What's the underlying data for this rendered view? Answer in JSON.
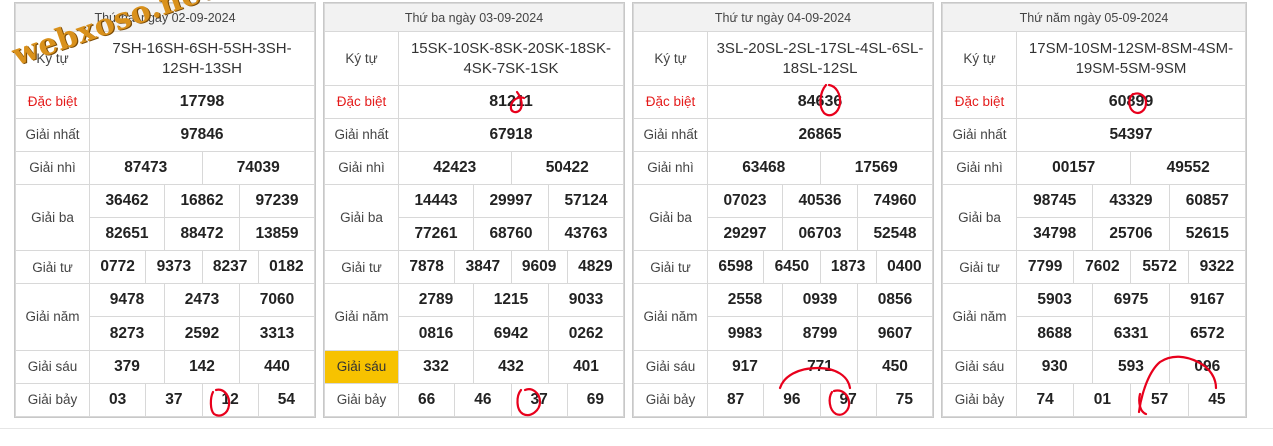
{
  "watermark": "webxoso.net",
  "labels": {
    "ky_tu": "Ký tự",
    "dac_biet": "Đặc biệt",
    "nhat": "Giải nhất",
    "nhi": "Giải nhì",
    "ba": "Giải ba",
    "tu": "Giải tư",
    "nam": "Giải năm",
    "sau": "Giải sáu",
    "bay": "Giải bảy"
  },
  "colors": {
    "special_text": "#e41b1b",
    "highlight_label": "#f7c200",
    "annotation": "#e8001c"
  },
  "tables": [
    {
      "date": "Thứ hai ngày 02-09-2024",
      "ky_tu": "7SH-16SH-6SH-5SH-3SH-12SH-13SH",
      "dac_biet": "17798",
      "nhat": "97846",
      "nhi": [
        "87473",
        "74039"
      ],
      "ba": [
        "36462",
        "16862",
        "97239",
        "82651",
        "88472",
        "13859"
      ],
      "tu": [
        "0772",
        "9373",
        "8237",
        "0182"
      ],
      "nam": [
        "9478",
        "2473",
        "7060",
        "8273",
        "2592",
        "3313"
      ],
      "sau": [
        "379",
        "142",
        "440"
      ],
      "bay": [
        "03",
        "37",
        "12",
        "54"
      ]
    },
    {
      "date": "Thứ ba ngày 03-09-2024",
      "ky_tu": "15SK-10SK-8SK-20SK-18SK-4SK-7SK-1SK",
      "dac_biet": "81211",
      "nhat": "67918",
      "nhi": [
        "42423",
        "50422"
      ],
      "ba": [
        "14443",
        "29997",
        "57124",
        "77261",
        "68760",
        "43763"
      ],
      "tu": [
        "7878",
        "3847",
        "9609",
        "4829"
      ],
      "nam": [
        "2789",
        "1215",
        "9033",
        "0816",
        "6942",
        "0262"
      ],
      "sau": [
        "332",
        "432",
        "401"
      ],
      "bay": [
        "66",
        "46",
        "37",
        "69"
      ]
    },
    {
      "date": "Thứ tư ngày 04-09-2024",
      "ky_tu": "3SL-20SL-2SL-17SL-4SL-6SL-18SL-12SL",
      "dac_biet": "84636",
      "nhat": "26865",
      "nhi": [
        "63468",
        "17569"
      ],
      "ba": [
        "07023",
        "40536",
        "74960",
        "29297",
        "06703",
        "52548"
      ],
      "tu": [
        "6598",
        "6450",
        "1873",
        "0400"
      ],
      "nam": [
        "2558",
        "0939",
        "0856",
        "9983",
        "8799",
        "9607"
      ],
      "sau": [
        "917",
        "771",
        "450"
      ],
      "bay": [
        "87",
        "96",
        "97",
        "75"
      ]
    },
    {
      "date": "Thứ năm ngày 05-09-2024",
      "ky_tu": "17SM-10SM-12SM-8SM-4SM-19SM-5SM-9SM",
      "dac_biet": "60899",
      "nhat": "54397",
      "nhi": [
        "00157",
        "49552"
      ],
      "ba": [
        "98745",
        "43329",
        "60857",
        "34798",
        "25706",
        "52615"
      ],
      "tu": [
        "7799",
        "7602",
        "5572",
        "9322"
      ],
      "nam": [
        "5903",
        "6975",
        "9167",
        "8688",
        "6331",
        "6572"
      ],
      "sau": [
        "930",
        "593",
        "096"
      ],
      "bay": [
        "74",
        "01",
        "57",
        "45"
      ]
    }
  ]
}
